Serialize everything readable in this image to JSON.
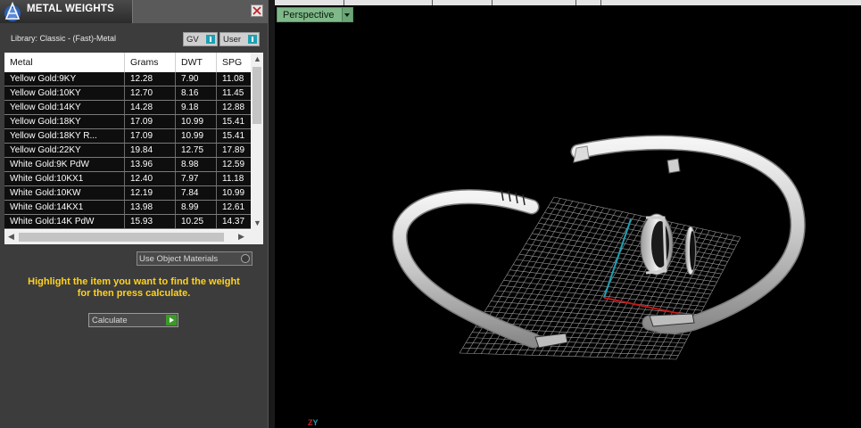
{
  "window": {
    "title": "METAL WEIGHTS"
  },
  "library": {
    "label": "Library: Classic - (Fast)-Metal"
  },
  "toggles": {
    "gv": "GV",
    "user": "User"
  },
  "table": {
    "columns": [
      "Metal",
      "Grams",
      "DWT",
      "SPG"
    ],
    "rows": [
      [
        "Yellow Gold:9KY",
        "12.28",
        "7.90",
        "11.08"
      ],
      [
        "Yellow Gold:10KY",
        "12.70",
        "8.16",
        "11.45"
      ],
      [
        "Yellow Gold:14KY",
        "14.28",
        "9.18",
        "12.88"
      ],
      [
        "Yellow Gold:18KY",
        "17.09",
        "10.99",
        "15.41"
      ],
      [
        "Yellow Gold:18KY R...",
        "17.09",
        "10.99",
        "15.41"
      ],
      [
        "Yellow Gold:22KY",
        "19.84",
        "12.75",
        "17.89"
      ],
      [
        "White Gold:9K PdW",
        "13.96",
        "8.98",
        "12.59"
      ],
      [
        "White Gold:10KX1",
        "12.40",
        "7.97",
        "11.18"
      ],
      [
        "White Gold:10KW",
        "12.19",
        "7.84",
        "10.99"
      ],
      [
        "White Gold:14KX1",
        "13.98",
        "8.99",
        "12.61"
      ],
      [
        "White Gold:14K PdW",
        "15.93",
        "10.25",
        "14.37"
      ]
    ]
  },
  "use_object_materials": {
    "label": "Use Object Materials"
  },
  "hint": {
    "line1": "Highlight the item you want to find the weight",
    "line2": "for then press calculate."
  },
  "calculate": {
    "label": "Calculate"
  },
  "viewport": {
    "view_label": "Perspective",
    "axis_z": "Z",
    "axis_y": "Y"
  },
  "colors": {
    "hint": "#ffd21f",
    "accent_teal": "#1fa0b4",
    "view_tab": "#7fb98a",
    "calc_go": "#3c9a28",
    "axis_x": "#c01818",
    "axis_y": "#1fa0b4"
  }
}
